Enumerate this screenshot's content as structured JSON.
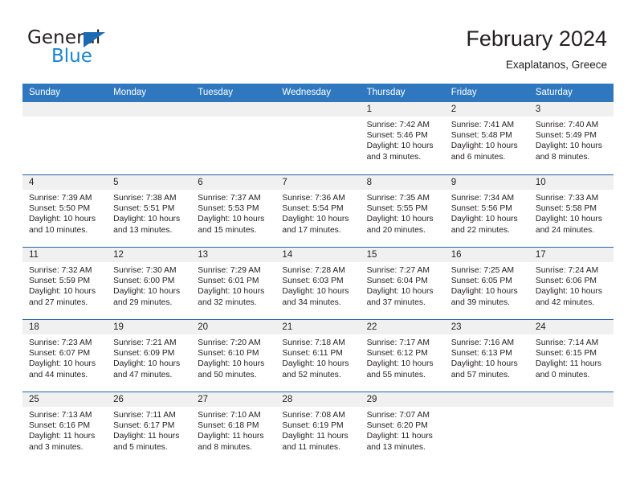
{
  "brand": {
    "name_top": "General",
    "name_bottom": "Blue",
    "colors": {
      "general": "#231f20",
      "blue": "#1a86d0",
      "triangle": "#1b6ab3"
    }
  },
  "header": {
    "title": "February 2024",
    "subtitle": "Exaplatanos, Greece"
  },
  "theme": {
    "header_row_bg": "#2f78bf",
    "header_row_text": "#ffffff",
    "row_divider": "#2463a8",
    "daynum_band_bg": "#f0f0f0",
    "cell_bg": "#ffffff",
    "text": "#231f20"
  },
  "calendar": {
    "weekdays": [
      "Sunday",
      "Monday",
      "Tuesday",
      "Wednesday",
      "Thursday",
      "Friday",
      "Saturday"
    ],
    "weeks": [
      [
        {
          "day": "",
          "lines": []
        },
        {
          "day": "",
          "lines": []
        },
        {
          "day": "",
          "lines": []
        },
        {
          "day": "",
          "lines": []
        },
        {
          "day": "1",
          "lines": [
            "Sunrise: 7:42 AM",
            "Sunset: 5:46 PM",
            "Daylight: 10 hours and 3 minutes."
          ]
        },
        {
          "day": "2",
          "lines": [
            "Sunrise: 7:41 AM",
            "Sunset: 5:48 PM",
            "Daylight: 10 hours and 6 minutes."
          ]
        },
        {
          "day": "3",
          "lines": [
            "Sunrise: 7:40 AM",
            "Sunset: 5:49 PM",
            "Daylight: 10 hours and 8 minutes."
          ]
        }
      ],
      [
        {
          "day": "4",
          "lines": [
            "Sunrise: 7:39 AM",
            "Sunset: 5:50 PM",
            "Daylight: 10 hours and 10 minutes."
          ]
        },
        {
          "day": "5",
          "lines": [
            "Sunrise: 7:38 AM",
            "Sunset: 5:51 PM",
            "Daylight: 10 hours and 13 minutes."
          ]
        },
        {
          "day": "6",
          "lines": [
            "Sunrise: 7:37 AM",
            "Sunset: 5:53 PM",
            "Daylight: 10 hours and 15 minutes."
          ]
        },
        {
          "day": "7",
          "lines": [
            "Sunrise: 7:36 AM",
            "Sunset: 5:54 PM",
            "Daylight: 10 hours and 17 minutes."
          ]
        },
        {
          "day": "8",
          "lines": [
            "Sunrise: 7:35 AM",
            "Sunset: 5:55 PM",
            "Daylight: 10 hours and 20 minutes."
          ]
        },
        {
          "day": "9",
          "lines": [
            "Sunrise: 7:34 AM",
            "Sunset: 5:56 PM",
            "Daylight: 10 hours and 22 minutes."
          ]
        },
        {
          "day": "10",
          "lines": [
            "Sunrise: 7:33 AM",
            "Sunset: 5:58 PM",
            "Daylight: 10 hours and 24 minutes."
          ]
        }
      ],
      [
        {
          "day": "11",
          "lines": [
            "Sunrise: 7:32 AM",
            "Sunset: 5:59 PM",
            "Daylight: 10 hours and 27 minutes."
          ]
        },
        {
          "day": "12",
          "lines": [
            "Sunrise: 7:30 AM",
            "Sunset: 6:00 PM",
            "Daylight: 10 hours and 29 minutes."
          ]
        },
        {
          "day": "13",
          "lines": [
            "Sunrise: 7:29 AM",
            "Sunset: 6:01 PM",
            "Daylight: 10 hours and 32 minutes."
          ]
        },
        {
          "day": "14",
          "lines": [
            "Sunrise: 7:28 AM",
            "Sunset: 6:03 PM",
            "Daylight: 10 hours and 34 minutes."
          ]
        },
        {
          "day": "15",
          "lines": [
            "Sunrise: 7:27 AM",
            "Sunset: 6:04 PM",
            "Daylight: 10 hours and 37 minutes."
          ]
        },
        {
          "day": "16",
          "lines": [
            "Sunrise: 7:25 AM",
            "Sunset: 6:05 PM",
            "Daylight: 10 hours and 39 minutes."
          ]
        },
        {
          "day": "17",
          "lines": [
            "Sunrise: 7:24 AM",
            "Sunset: 6:06 PM",
            "Daylight: 10 hours and 42 minutes."
          ]
        }
      ],
      [
        {
          "day": "18",
          "lines": [
            "Sunrise: 7:23 AM",
            "Sunset: 6:07 PM",
            "Daylight: 10 hours and 44 minutes."
          ]
        },
        {
          "day": "19",
          "lines": [
            "Sunrise: 7:21 AM",
            "Sunset: 6:09 PM",
            "Daylight: 10 hours and 47 minutes."
          ]
        },
        {
          "day": "20",
          "lines": [
            "Sunrise: 7:20 AM",
            "Sunset: 6:10 PM",
            "Daylight: 10 hours and 50 minutes."
          ]
        },
        {
          "day": "21",
          "lines": [
            "Sunrise: 7:18 AM",
            "Sunset: 6:11 PM",
            "Daylight: 10 hours and 52 minutes."
          ]
        },
        {
          "day": "22",
          "lines": [
            "Sunrise: 7:17 AM",
            "Sunset: 6:12 PM",
            "Daylight: 10 hours and 55 minutes."
          ]
        },
        {
          "day": "23",
          "lines": [
            "Sunrise: 7:16 AM",
            "Sunset: 6:13 PM",
            "Daylight: 10 hours and 57 minutes."
          ]
        },
        {
          "day": "24",
          "lines": [
            "Sunrise: 7:14 AM",
            "Sunset: 6:15 PM",
            "Daylight: 11 hours and 0 minutes."
          ]
        }
      ],
      [
        {
          "day": "25",
          "lines": [
            "Sunrise: 7:13 AM",
            "Sunset: 6:16 PM",
            "Daylight: 11 hours and 3 minutes."
          ]
        },
        {
          "day": "26",
          "lines": [
            "Sunrise: 7:11 AM",
            "Sunset: 6:17 PM",
            "Daylight: 11 hours and 5 minutes."
          ]
        },
        {
          "day": "27",
          "lines": [
            "Sunrise: 7:10 AM",
            "Sunset: 6:18 PM",
            "Daylight: 11 hours and 8 minutes."
          ]
        },
        {
          "day": "28",
          "lines": [
            "Sunrise: 7:08 AM",
            "Sunset: 6:19 PM",
            "Daylight: 11 hours and 11 minutes."
          ]
        },
        {
          "day": "29",
          "lines": [
            "Sunrise: 7:07 AM",
            "Sunset: 6:20 PM",
            "Daylight: 11 hours and 13 minutes."
          ]
        },
        {
          "day": "",
          "lines": []
        },
        {
          "day": "",
          "lines": []
        }
      ]
    ]
  }
}
